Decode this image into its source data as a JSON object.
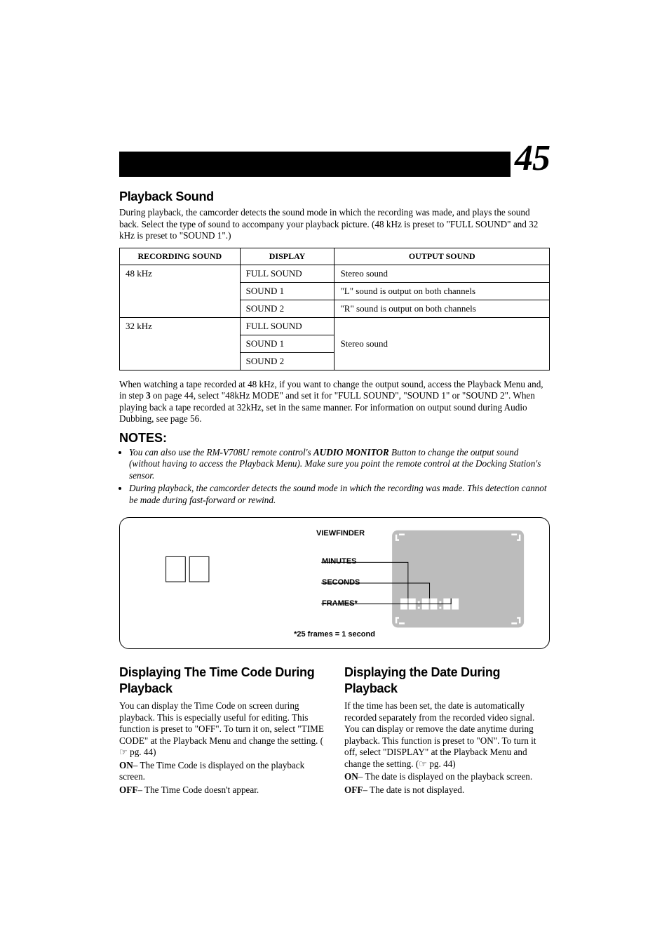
{
  "page_number": "45",
  "playback_sound": {
    "title": "Playback Sound",
    "intro": "During playback, the camcorder detects the sound mode in which the recording was made, and plays the sound back. Select the type of sound to accompany your playback picture. (48 kHz is preset to \"FULL SOUND\" and 32 kHz is preset to \"SOUND 1\".)",
    "table": {
      "headers": {
        "recording": "RECORDING SOUND",
        "display": "DISPLAY",
        "output": "OUTPUT SOUND"
      },
      "rows": [
        {
          "recording": "48 kHz",
          "display": "FULL SOUND",
          "output": "Stereo sound"
        },
        {
          "recording": "",
          "display": "SOUND 1",
          "output": "\"L\" sound is output on both channels"
        },
        {
          "recording": "",
          "display": "SOUND 2",
          "output": "\"R\" sound is output on both channels"
        },
        {
          "recording": "32 kHz",
          "display": "FULL SOUND",
          "output": ""
        },
        {
          "recording": "",
          "display": "SOUND 1",
          "output": "Stereo sound"
        },
        {
          "recording": "",
          "display": "SOUND 2",
          "output": ""
        }
      ]
    },
    "after_table_1": "When watching a tape recorded at 48 kHz, if you want to change the output sound, access the Playback Menu and, in step ",
    "after_table_step": "3",
    "after_table_2": " on page 44, select \"48kHz MODE\" and set it for \"FULL SOUND\", \"SOUND 1\" or \"SOUND 2\". When playing back a tape recorded at 32kHz, set in the same manner. For information on output sound during Audio Dubbing, see page 56."
  },
  "notes": {
    "heading": "NOTES:",
    "items": [
      {
        "pre": "You can also use the RM-V708U remote control's ",
        "bold": "AUDIO MONITOR",
        "post": " Button to change the output sound (without having to access the Playback Menu). Make sure you point the remote control at the Docking Station's sensor."
      },
      {
        "pre": "During playback, the camcorder detects the sound mode in which the recording was made. This detection cannot be made during fast-forward or rewind.",
        "bold": "",
        "post": ""
      }
    ]
  },
  "figure": {
    "viewfinder": "VIEWFINDER",
    "minutes": "MINUTES",
    "seconds": "SECONDS",
    "frames": "FRAMES*",
    "footnote": "*25 frames = 1 second"
  },
  "timecode": {
    "title": "Displaying The Time Code During Playback",
    "body": "You can display the Time Code on screen during playback. This is especially useful for editing. This function is preset to \"OFF\". To turn it on, select \"TIME CODE\" at the Playback Menu and change the setting. (",
    "pgref": "☞ pg. 44)",
    "on_key": "ON",
    "on_sep": "– ",
    "on_val": "The Time Code is displayed on the playback screen.",
    "off_key": "OFF",
    "off_sep": "– ",
    "off_val": "The Time Code doesn't appear."
  },
  "date": {
    "title": "Displaying the Date During Playback",
    "body": "If the time has been set, the date is automatically recorded separately from the recorded video signal. You can display or remove the date anytime during playback. This function is preset to \"ON\". To turn it off, select \"DISPLAY\" at the Playback Menu and change the setting. (",
    "pgref": "☞ pg. 44)",
    "on_key": "ON",
    "on_sep": "– ",
    "on_val": "The date is displayed on the playback screen.",
    "off_key": "OFF",
    "off_sep": "– ",
    "off_val": "The date is not displayed."
  }
}
